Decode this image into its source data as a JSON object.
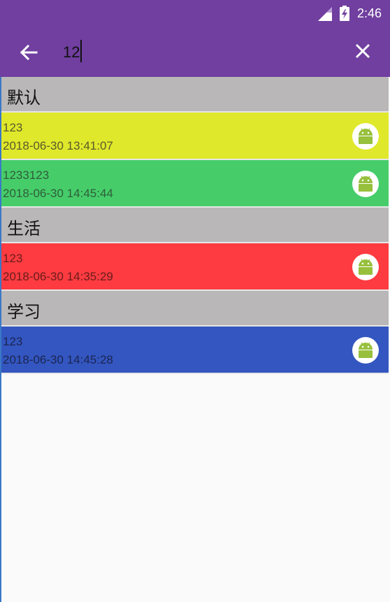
{
  "status": {
    "time": "2:46"
  },
  "search": {
    "query": "12"
  },
  "groups": [
    {
      "name": "默认",
      "notes": [
        {
          "title": "123",
          "time": "2018-06-30 13:41:07",
          "bg": "#dfe82a",
          "fg": "#5a5a2a"
        },
        {
          "title": "1233123",
          "time": "2018-06-30 14:45:44",
          "bg": "#46cd6a",
          "fg": "#2e5e3a"
        }
      ]
    },
    {
      "name": "生活",
      "notes": [
        {
          "title": "123",
          "time": "2018-06-30 14:35:29",
          "bg": "#fd3b40",
          "fg": "#6a1c1c"
        }
      ]
    },
    {
      "name": "学习",
      "notes": [
        {
          "title": "123",
          "time": "2018-06-30 14:45:28",
          "bg": "#3356c0",
          "fg": "#1c2552"
        }
      ]
    }
  ],
  "colors": {
    "appbar": "#703f9f",
    "group_header": "#b9b7b8",
    "android_green": "#97c03d"
  }
}
